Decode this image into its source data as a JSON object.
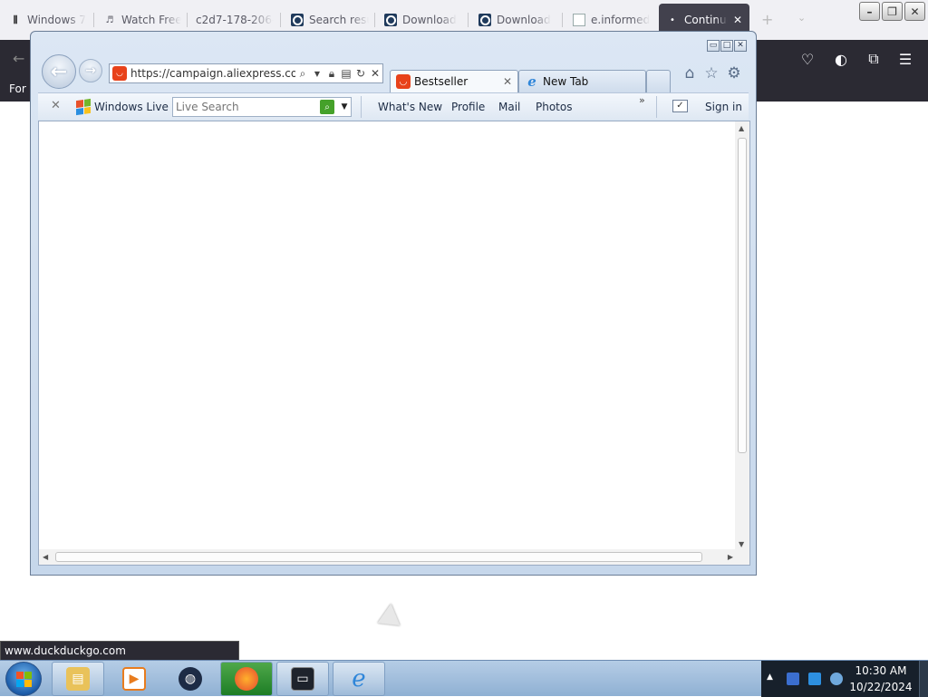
{
  "firefox": {
    "tabs": [
      {
        "label": "Windows 7",
        "icon": "bars-icon"
      },
      {
        "label": "Watch Free",
        "icon": "music-icon"
      },
      {
        "label": "c2d7-178-206-",
        "icon": "none"
      },
      {
        "label": "Search resu",
        "icon": "duckduckgo-icon"
      },
      {
        "label": "Download",
        "icon": "duckduckgo-icon"
      },
      {
        "label": "Download",
        "icon": "duckduckgo-icon"
      },
      {
        "label": "e.informed",
        "icon": "document-icon"
      },
      {
        "label": "Continue",
        "icon": "dot-icon",
        "active": true
      }
    ],
    "new_tab": "+",
    "tab_list": "⌄",
    "back": "←",
    "bookmark_bar_text": "For q",
    "status_url": "www.duckduckgo.com",
    "window_buttons": {
      "minimize": "–",
      "restore": "❐",
      "close": "✕"
    }
  },
  "ie": {
    "address_url": "https://campaign.aliexpress.com/",
    "tabs": [
      {
        "label": "Bestseller",
        "icon": "aliexpress-icon",
        "active": true
      },
      {
        "label": "New Tab",
        "icon": "ie-icon"
      }
    ],
    "toolbar": {
      "brand": "Windows Live",
      "search_placeholder": "Live Search",
      "links": [
        "What's New",
        "Profile",
        "Mail",
        "Photos"
      ],
      "more": "»",
      "sign_in": "Sign in"
    }
  },
  "taskbar": {
    "time": "10:30 AM",
    "date": "10/22/2024",
    "pinned": [
      "file-explorer-icon",
      "media-player-icon",
      "globe-icon",
      "firefox-icon",
      "monitor-icon",
      "internet-explorer-icon"
    ]
  },
  "colors": {
    "firefox_dark": "#2b2a33",
    "ie_frame": "#c6d7eb",
    "aliexpress_red": "#e8421a",
    "tray_bg": "#17202b"
  }
}
